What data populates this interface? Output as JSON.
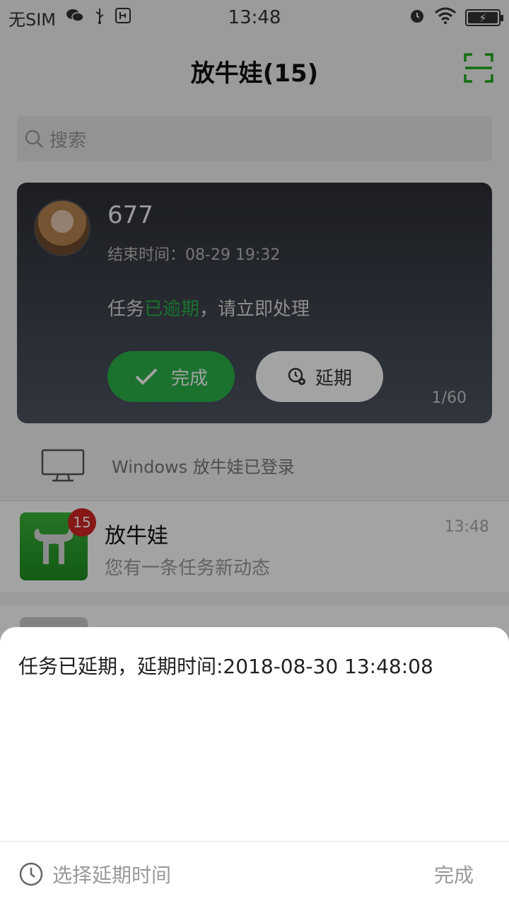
{
  "status_bar": {
    "carrier": "无SIM",
    "time": "13:48",
    "battery_icon": "battery-charging-icon"
  },
  "header": {
    "title": "放牛娃(15)",
    "scan_icon": "scan-icon",
    "accent_color": "#1aad19"
  },
  "search": {
    "placeholder": "搜索"
  },
  "task_card": {
    "title": "677",
    "deadline_label": "结束时间：",
    "deadline_value": "08-29 19:32",
    "msg_prefix": "任务",
    "msg_highlight": "已逾期",
    "msg_suffix": "，请立即处理",
    "done_label": "完成",
    "delay_label": "延期",
    "counter": "1/60",
    "highlight_color": "#2bb34a"
  },
  "login_notice": {
    "text": "Windows 放牛娃已登录"
  },
  "chat_list": [
    {
      "name": "放牛娃",
      "preview": "您有一条任务新动态",
      "time": "13:48",
      "badge": "15"
    }
  ],
  "sheet": {
    "message": "任务已延期，延期时间:2018-08-30 13:48:08",
    "choose_label": "选择延期时间",
    "done_label": "完成"
  }
}
